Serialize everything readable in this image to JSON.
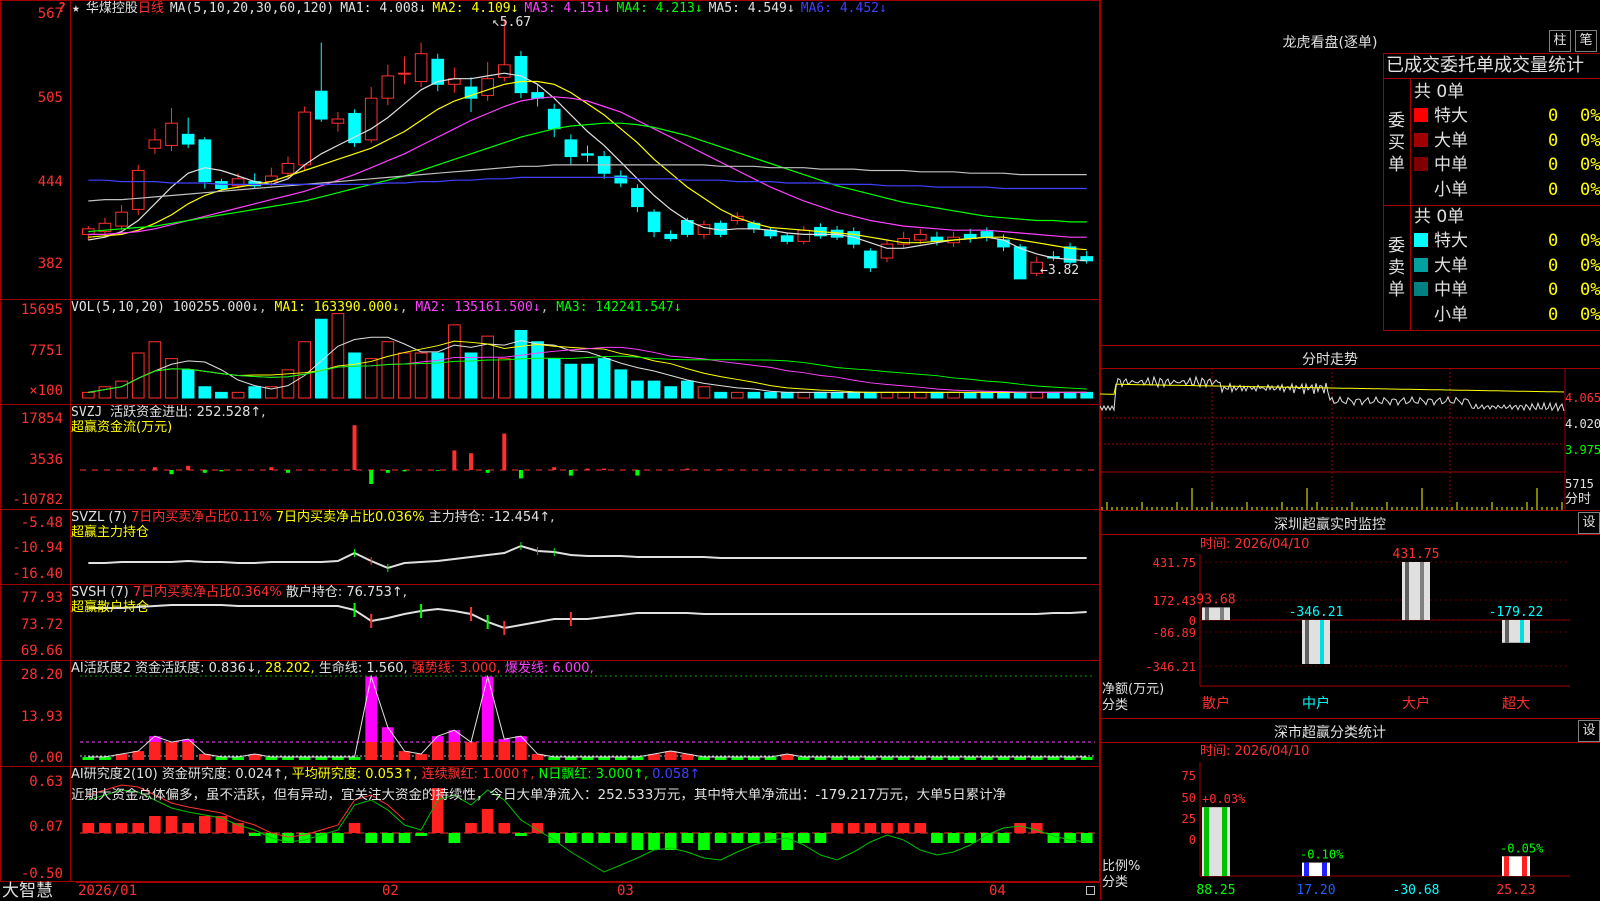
{
  "stock": {
    "name_prefix": "★",
    "name": "华煤控股",
    "period": "日线",
    "ma_label": "MA(5,10,20,30,60,120)",
    "ma_values": [
      {
        "label": "MA1: 4.008↓",
        "color": "#e0e0e0"
      },
      {
        "label": "MA2: 4.109↓",
        "color": "#ffff00"
      },
      {
        "label": "MA3: 4.151↓",
        "color": "#ff40ff"
      },
      {
        "label": "MA4: 4.213↓",
        "color": "#00ff00"
      },
      {
        "label": "MA5: 4.549↓",
        "color": "#e0e0e0"
      },
      {
        "label": "MA6: 4.452↓",
        "color": "#4040ff"
      }
    ],
    "y_labels": [
      "567",
      "505",
      "444",
      "382"
    ],
    "high_mark": "5.67",
    "low_mark": "←3.82",
    "price_candles": [
      {
        "o": 4.12,
        "c": 4.16,
        "h": 4.18,
        "l": 4.08
      },
      {
        "o": 4.14,
        "c": 4.2,
        "h": 4.24,
        "l": 4.1
      },
      {
        "o": 4.18,
        "c": 4.28,
        "h": 4.33,
        "l": 4.15
      },
      {
        "o": 4.3,
        "c": 4.58,
        "h": 4.62,
        "l": 4.26
      },
      {
        "o": 4.74,
        "c": 4.8,
        "h": 4.88,
        "l": 4.7
      },
      {
        "o": 4.76,
        "c": 4.92,
        "h": 5.03,
        "l": 4.72
      },
      {
        "o": 4.84,
        "c": 4.77,
        "h": 4.96,
        "l": 4.74
      },
      {
        "o": 4.8,
        "c": 4.5,
        "h": 4.82,
        "l": 4.45
      },
      {
        "o": 4.5,
        "c": 4.45,
        "h": 4.52,
        "l": 4.43
      },
      {
        "o": 4.47,
        "c": 4.52,
        "h": 4.56,
        "l": 4.45
      },
      {
        "o": 4.5,
        "c": 4.47,
        "h": 4.56,
        "l": 4.45
      },
      {
        "o": 4.5,
        "c": 4.54,
        "h": 4.6,
        "l": 4.47
      },
      {
        "o": 4.56,
        "c": 4.63,
        "h": 4.68,
        "l": 4.52
      },
      {
        "o": 4.62,
        "c": 5.0,
        "h": 5.04,
        "l": 4.58
      },
      {
        "o": 5.15,
        "c": 4.95,
        "h": 5.5,
        "l": 4.93
      },
      {
        "o": 4.92,
        "c": 4.95,
        "h": 5.0,
        "l": 4.86
      },
      {
        "o": 4.99,
        "c": 4.78,
        "h": 5.02,
        "l": 4.75
      },
      {
        "o": 4.8,
        "c": 5.1,
        "h": 5.18,
        "l": 4.78
      },
      {
        "o": 5.1,
        "c": 5.26,
        "h": 5.34,
        "l": 5.05
      },
      {
        "o": 5.28,
        "c": 5.28,
        "h": 5.4,
        "l": 5.2
      },
      {
        "o": 5.22,
        "c": 5.42,
        "h": 5.5,
        "l": 5.18
      },
      {
        "o": 5.38,
        "c": 5.2,
        "h": 5.42,
        "l": 5.15
      },
      {
        "o": 5.2,
        "c": 5.24,
        "h": 5.32,
        "l": 5.14
      },
      {
        "o": 5.18,
        "c": 5.1,
        "h": 5.25,
        "l": 5.0
      },
      {
        "o": 5.12,
        "c": 5.24,
        "h": 5.36,
        "l": 5.08
      },
      {
        "o": 5.25,
        "c": 5.34,
        "h": 5.67,
        "l": 5.22
      },
      {
        "o": 5.4,
        "c": 5.14,
        "h": 5.44,
        "l": 5.1
      },
      {
        "o": 5.14,
        "c": 5.1,
        "h": 5.2,
        "l": 5.04
      },
      {
        "o": 5.02,
        "c": 4.88,
        "h": 5.06,
        "l": 4.82
      },
      {
        "o": 4.8,
        "c": 4.68,
        "h": 4.84,
        "l": 4.62
      },
      {
        "o": 4.7,
        "c": 4.69,
        "h": 4.76,
        "l": 4.64
      },
      {
        "o": 4.68,
        "c": 4.56,
        "h": 4.72,
        "l": 4.52
      },
      {
        "o": 4.54,
        "c": 4.49,
        "h": 4.58,
        "l": 4.46
      },
      {
        "o": 4.45,
        "c": 4.32,
        "h": 4.48,
        "l": 4.28
      },
      {
        "o": 4.28,
        "c": 4.14,
        "h": 4.3,
        "l": 4.1
      },
      {
        "o": 4.12,
        "c": 4.09,
        "h": 4.15,
        "l": 4.07
      },
      {
        "o": 4.22,
        "c": 4.12,
        "h": 4.24,
        "l": 4.1
      },
      {
        "o": 4.12,
        "c": 4.19,
        "h": 4.22,
        "l": 4.09
      },
      {
        "o": 4.2,
        "c": 4.12,
        "h": 4.22,
        "l": 4.1
      },
      {
        "o": 4.22,
        "c": 4.25,
        "h": 4.28,
        "l": 4.19
      },
      {
        "o": 4.2,
        "c": 4.16,
        "h": 4.22,
        "l": 4.13
      },
      {
        "o": 4.15,
        "c": 4.11,
        "h": 4.17,
        "l": 4.09
      },
      {
        "o": 4.11,
        "c": 4.07,
        "h": 4.13,
        "l": 4.05
      },
      {
        "o": 4.07,
        "c": 4.15,
        "h": 4.18,
        "l": 4.05
      },
      {
        "o": 4.17,
        "c": 4.11,
        "h": 4.2,
        "l": 4.09
      },
      {
        "o": 4.15,
        "c": 4.1,
        "h": 4.18,
        "l": 4.08
      },
      {
        "o": 4.14,
        "c": 4.05,
        "h": 4.17,
        "l": 4.02
      },
      {
        "o": 4.0,
        "c": 3.88,
        "h": 4.02,
        "l": 3.85
      },
      {
        "o": 3.95,
        "c": 4.05,
        "h": 4.08,
        "l": 3.92
      },
      {
        "o": 4.05,
        "c": 4.09,
        "h": 4.14,
        "l": 4.02
      },
      {
        "o": 4.08,
        "c": 4.12,
        "h": 4.16,
        "l": 4.05
      },
      {
        "o": 4.1,
        "c": 4.07,
        "h": 4.14,
        "l": 4.04
      },
      {
        "o": 4.06,
        "c": 4.1,
        "h": 4.14,
        "l": 4.03
      },
      {
        "o": 4.12,
        "c": 4.09,
        "h": 4.16,
        "l": 4.06
      },
      {
        "o": 4.14,
        "c": 4.1,
        "h": 4.17,
        "l": 4.07
      },
      {
        "o": 4.08,
        "c": 4.03,
        "h": 4.12,
        "l": 4.0
      },
      {
        "o": 4.03,
        "c": 3.8,
        "h": 4.05,
        "l": 3.8
      },
      {
        "o": 3.84,
        "c": 3.92,
        "h": 3.96,
        "l": 3.82
      },
      {
        "o": 3.96,
        "c": 3.95,
        "h": 4.0,
        "l": 3.93
      },
      {
        "o": 4.03,
        "c": 3.92,
        "h": 4.06,
        "l": 3.9
      },
      {
        "o": 3.96,
        "c": 3.93,
        "h": 4.0,
        "l": 3.91
      }
    ],
    "ma_lines": {
      "ma5": [
        4.08,
        4.1,
        4.14,
        4.22,
        4.34,
        4.46,
        4.56,
        4.6,
        4.58,
        4.54,
        4.5,
        4.48,
        4.52,
        4.62,
        4.7,
        4.76,
        4.82,
        4.88,
        4.96,
        5.06,
        5.16,
        5.22,
        5.24,
        5.24,
        5.26,
        5.28,
        5.26,
        5.2,
        5.1,
        4.98,
        4.86,
        4.76,
        4.64,
        4.52,
        4.4,
        4.3,
        4.22,
        4.17,
        4.15,
        4.16,
        4.16,
        4.15,
        4.13,
        4.12,
        4.12,
        4.12,
        4.1,
        4.06,
        4.02,
        4.02,
        4.04,
        4.06,
        4.08,
        4.09,
        4.1,
        4.08,
        4.02,
        3.98,
        3.95,
        3.94,
        3.93
      ],
      "ma10": [
        4.1,
        4.11,
        4.12,
        4.15,
        4.2,
        4.26,
        4.34,
        4.4,
        4.44,
        4.46,
        4.48,
        4.5,
        4.54,
        4.58,
        4.62,
        4.66,
        4.7,
        4.74,
        4.8,
        4.86,
        4.94,
        5.02,
        5.08,
        5.12,
        5.16,
        5.2,
        5.22,
        5.22,
        5.2,
        5.14,
        5.06,
        4.98,
        4.88,
        4.78,
        4.66,
        4.56,
        4.46,
        4.38,
        4.3,
        4.24,
        4.2,
        4.17,
        4.16,
        4.15,
        4.14,
        4.13,
        4.12,
        4.1,
        4.08,
        4.06,
        4.06,
        4.07,
        4.08,
        4.09,
        4.1,
        4.1,
        4.08,
        4.06,
        4.04,
        4.02,
        4.01
      ],
      "ma20": [
        4.12,
        4.12,
        4.13,
        4.14,
        4.16,
        4.19,
        4.22,
        4.25,
        4.28,
        4.31,
        4.34,
        4.37,
        4.4,
        4.43,
        4.47,
        4.51,
        4.55,
        4.6,
        4.65,
        4.7,
        4.76,
        4.82,
        4.88,
        4.94,
        4.99,
        5.04,
        5.08,
        5.1,
        5.11,
        5.1,
        5.08,
        5.04,
        5.0,
        4.94,
        4.88,
        4.82,
        4.76,
        4.7,
        4.64,
        4.58,
        4.52,
        4.46,
        4.41,
        4.36,
        4.32,
        4.28,
        4.25,
        4.22,
        4.2,
        4.18,
        4.17,
        4.16,
        4.15,
        4.15,
        4.15,
        4.14,
        4.13,
        4.12,
        4.11,
        4.1,
        4.1
      ],
      "ma30": [
        4.14,
        4.15,
        4.16,
        4.17,
        4.18,
        4.2,
        4.22,
        4.24,
        4.26,
        4.28,
        4.3,
        4.32,
        4.34,
        4.36,
        4.39,
        4.42,
        4.45,
        4.48,
        4.51,
        4.54,
        4.58,
        4.62,
        4.66,
        4.7,
        4.74,
        4.78,
        4.82,
        4.85,
        4.88,
        4.9,
        4.91,
        4.92,
        4.92,
        4.91,
        4.89,
        4.86,
        4.83,
        4.79,
        4.75,
        4.71,
        4.67,
        4.63,
        4.59,
        4.55,
        4.51,
        4.47,
        4.44,
        4.41,
        4.38,
        4.35,
        4.33,
        4.31,
        4.29,
        4.27,
        4.25,
        4.24,
        4.23,
        4.22,
        4.22,
        4.21,
        4.21
      ],
      "ma60": [
        4.36,
        4.37,
        4.37,
        4.38,
        4.39,
        4.4,
        4.41,
        4.42,
        4.43,
        4.44,
        4.45,
        4.46,
        4.47,
        4.48,
        4.49,
        4.5,
        4.51,
        4.52,
        4.53,
        4.54,
        4.55,
        4.56,
        4.57,
        4.58,
        4.59,
        4.6,
        4.61,
        4.61,
        4.62,
        4.62,
        4.62,
        4.62,
        4.62,
        4.62,
        4.62,
        4.62,
        4.62,
        4.62,
        4.61,
        4.61,
        4.61,
        4.6,
        4.6,
        4.6,
        4.59,
        4.59,
        4.59,
        4.58,
        4.58,
        4.58,
        4.57,
        4.57,
        4.57,
        4.56,
        4.56,
        4.56,
        4.55,
        4.55,
        4.55,
        4.55,
        4.55
      ],
      "ma120": [
        4.51,
        4.51,
        4.5,
        4.5,
        4.5,
        4.49,
        4.49,
        4.49,
        4.48,
        4.48,
        4.48,
        4.48,
        4.48,
        4.48,
        4.48,
        4.48,
        4.48,
        4.48,
        4.49,
        4.49,
        4.5,
        4.5,
        4.51,
        4.51,
        4.52,
        4.52,
        4.53,
        4.53,
        4.53,
        4.53,
        4.53,
        4.53,
        4.53,
        4.52,
        4.52,
        4.52,
        4.51,
        4.51,
        4.51,
        4.5,
        4.5,
        4.5,
        4.49,
        4.49,
        4.49,
        4.48,
        4.48,
        4.48,
        4.47,
        4.47,
        4.47,
        4.46,
        4.46,
        4.46,
        4.46,
        4.45,
        4.45,
        4.45,
        4.45,
        4.45,
        4.45
      ]
    }
  },
  "vol": {
    "header": "VOL(5,10,20)",
    "value": "100255.000↓",
    "ma1": "MA1: 163390.000↓",
    "ma2": "MA2: 135161.500↓",
    "ma3": "MA3: 142241.547↓",
    "y_labels": [
      "15695",
      "7751",
      "×100"
    ],
    "bars": [
      1,
      2,
      3,
      8,
      10,
      7,
      5,
      2,
      1,
      1,
      2,
      2,
      5,
      10,
      14,
      15,
      8,
      7,
      10,
      8,
      8,
      8,
      13,
      8,
      11,
      7,
      12,
      10,
      7,
      6,
      6,
      7,
      5,
      3,
      3,
      2,
      3,
      2,
      1,
      1,
      1,
      1,
      1,
      1,
      1,
      1,
      1,
      1,
      1,
      1,
      1,
      1,
      1,
      1,
      1,
      1,
      1,
      1,
      1,
      1,
      1
    ]
  },
  "svzj": {
    "header": "SVZJ",
    "label1": "活跃资金进出: 252.528↑,",
    "label2": "超赢资金流(万元)",
    "y_labels": [
      "17854",
      "3536",
      "-10782"
    ],
    "values": [
      0,
      0,
      0,
      0,
      1,
      -1.5,
      1.5,
      -1,
      -0.5,
      0,
      0,
      1,
      -1,
      0,
      0,
      0,
      16,
      -5,
      -1,
      -0.5,
      0,
      -0.3,
      7,
      6,
      -1,
      13,
      -3,
      0,
      1,
      -2,
      0.5,
      0.5,
      0,
      -2,
      0,
      0,
      0.5,
      0,
      0.3,
      0,
      0,
      0,
      0,
      0,
      0,
      0,
      0,
      0,
      0,
      0,
      0,
      0,
      0,
      0,
      0,
      0,
      0,
      0,
      0,
      0,
      0
    ]
  },
  "svzl": {
    "header": "SVZL (7)",
    "label1": "7日内买卖净占比0.11%",
    "label2": "7日内买卖净占比0.036%",
    "label3": "主力持仓: -12.454↑,",
    "label4": "超赢主力持仓",
    "y_labels": [
      "-5.48",
      "-10.94",
      "-16.40"
    ]
  },
  "svsh": {
    "header": "SVSH (7)",
    "label1": "7日内买卖净占比0.364%",
    "label2": "散户持仓: 76.753↑,",
    "label3": "超赢散户持仓",
    "y_labels": [
      "77.93",
      "73.72",
      "69.66"
    ]
  },
  "ai1": {
    "header": "AI活跃度2",
    "label1": "资金活跃度: 0.836↓,",
    "label2": "28.202,",
    "label3": "生命线: 1.560,",
    "label4": "强势线: 3.000,",
    "label5": "爆发线: 6.000,",
    "y_labels": [
      "28.20",
      "13.93",
      "0.00"
    ],
    "bars": [
      1,
      1,
      2,
      3,
      8,
      6,
      7,
      2,
      1,
      1,
      2,
      1,
      1,
      1,
      1,
      1,
      1,
      28,
      11,
      3,
      2,
      8,
      10,
      6,
      28,
      7,
      8,
      2,
      1,
      1,
      1,
      1,
      1,
      1,
      2,
      3,
      2,
      1,
      1,
      1,
      1,
      1,
      2,
      1,
      1,
      1,
      1,
      1,
      1,
      1,
      1,
      1,
      1,
      1,
      1,
      1,
      1,
      1,
      1,
      1,
      1
    ]
  },
  "ai2": {
    "header": "AI研究度2(10)",
    "label1": "资金研究度: 0.024↑,",
    "label2": "平均研究度: 0.053↑,",
    "label3": "连续飘红: 1.000↑,",
    "label4": "N日飘红: 3.000↑,",
    "label5": "0.058↑",
    "summary": "近期大资金总体偏多，虽不活跃，但有异动，宜关注大资金的持续性，今日大单净流入：252.533万元，其中特大单净流出：-179.217万元，大单5日累计净",
    "y_labels": [
      "0.63",
      "0.07",
      "-0.50"
    ]
  },
  "x_axis": {
    "labels": [
      "2026/01",
      "02",
      "03",
      "04"
    ]
  },
  "bottom_left": "大智慧",
  "right": {
    "lhb_title": "龙虎看盘(逐单)",
    "btn_zhu": "柱",
    "btn_bi": "笔",
    "tab_title": "已成交委托单成交量统计",
    "buy_total": "共 0单",
    "buy_side": "委买单",
    "sell_total": "共 0单",
    "sell_side": "委卖单",
    "rows": [
      {
        "label": "特大",
        "qty": "0",
        "pct": "0%"
      },
      {
        "label": "大单",
        "qty": "0",
        "pct": "0%"
      },
      {
        "label": "中单",
        "qty": "0",
        "pct": "0%"
      },
      {
        "label": "小单",
        "qty": "0",
        "pct": "0%"
      }
    ],
    "buy_colors": [
      "#ff0000",
      "#a00000",
      "#800000",
      ""
    ],
    "sell_colors": [
      "#00ffff",
      "#00a0a0",
      "#008080",
      ""
    ],
    "intraday_title": "分时走势",
    "intraday_labels": [
      "4.065",
      "4.020",
      "3.975",
      "5715",
      "分时"
    ],
    "sz_title": "深圳超赢实时监控",
    "sz_set": "设",
    "sz_time": "时间: 2026/04/10",
    "sz_y": [
      "431.75",
      "172.43",
      "0",
      "-86.89",
      "-346.21"
    ],
    "sz_bars": [
      {
        "cat": "散户",
        "value": "93.68",
        "num": 93.68
      },
      {
        "cat": "中户",
        "value": "-346.21",
        "num": -346.21
      },
      {
        "cat": "大户",
        "value": "431.75",
        "num": 431.75
      },
      {
        "cat": "超大",
        "value": "-179.22",
        "num": -179.22
      }
    ],
    "sz_ylabel1": "净额(万元)",
    "sz_ylabel2": "分类",
    "ss_title": "深市超赢分类统计",
    "ss_set": "设",
    "ss_time": "时间: 2026/04/10",
    "ss_y": [
      "75",
      "50",
      "25",
      "0"
    ],
    "ss_bars": [
      {
        "cat": "散户",
        "top": "+0.03%",
        "val": "88.25",
        "num": 88.25
      },
      {
        "cat": "中户",
        "top": "-0.10%",
        "val": "17.20",
        "num": 17.2
      },
      {
        "cat": "大户",
        "top": "",
        "val": "-30.68",
        "num": 0
      },
      {
        "cat": "超大",
        "top": "-0.05%",
        "val": "25.23",
        "num": 25.23
      }
    ],
    "ss_ylabel1": "比例%",
    "ss_ylabel2": "分类"
  }
}
